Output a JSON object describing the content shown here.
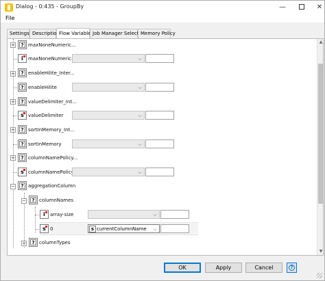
{
  "window": {
    "title": "Dialog - 0:435 - GroupBy",
    "min_icon": "—",
    "close_icon": "✕"
  },
  "menu": {
    "file": "File"
  },
  "tabs": [
    {
      "label": "Settings"
    },
    {
      "label": "Description"
    },
    {
      "label": "Flow Variables"
    },
    {
      "label": "Job Manager Selection"
    },
    {
      "label": "Memory Policy"
    }
  ],
  "tree": [
    {
      "label": "maxNoneNumeric..."
    },
    {
      "label": "maxNoneNumeric..."
    },
    {
      "label": "enableHilite_Inter..."
    },
    {
      "label": "enableHilite"
    },
    {
      "label": "valueDelimiter_Int..."
    },
    {
      "label": "valueDelimiter"
    },
    {
      "label": "sortInMemory_Int..."
    },
    {
      "label": "sortInMemory"
    },
    {
      "label": "columnNamePolicy..."
    },
    {
      "label": "columnNamePolicy"
    },
    {
      "label": "aggregationColumn"
    },
    {
      "label": "columnNames"
    },
    {
      "label": "array-size"
    },
    {
      "label": "0"
    },
    {
      "label": "columnTypes"
    }
  ],
  "icons": {
    "config": "?",
    "int": "i",
    "string": "s",
    "expand": "+",
    "collapse": "−",
    "dropdown": "⌵",
    "up": "▲",
    "down": "▼"
  },
  "selected_variable": "currentColumnName",
  "buttons": {
    "ok": "OK",
    "apply": "Apply",
    "cancel": "Cancel"
  },
  "colors": {
    "accent": "#0078d7",
    "app_icon": "#f6c000",
    "flag": "#d22"
  }
}
